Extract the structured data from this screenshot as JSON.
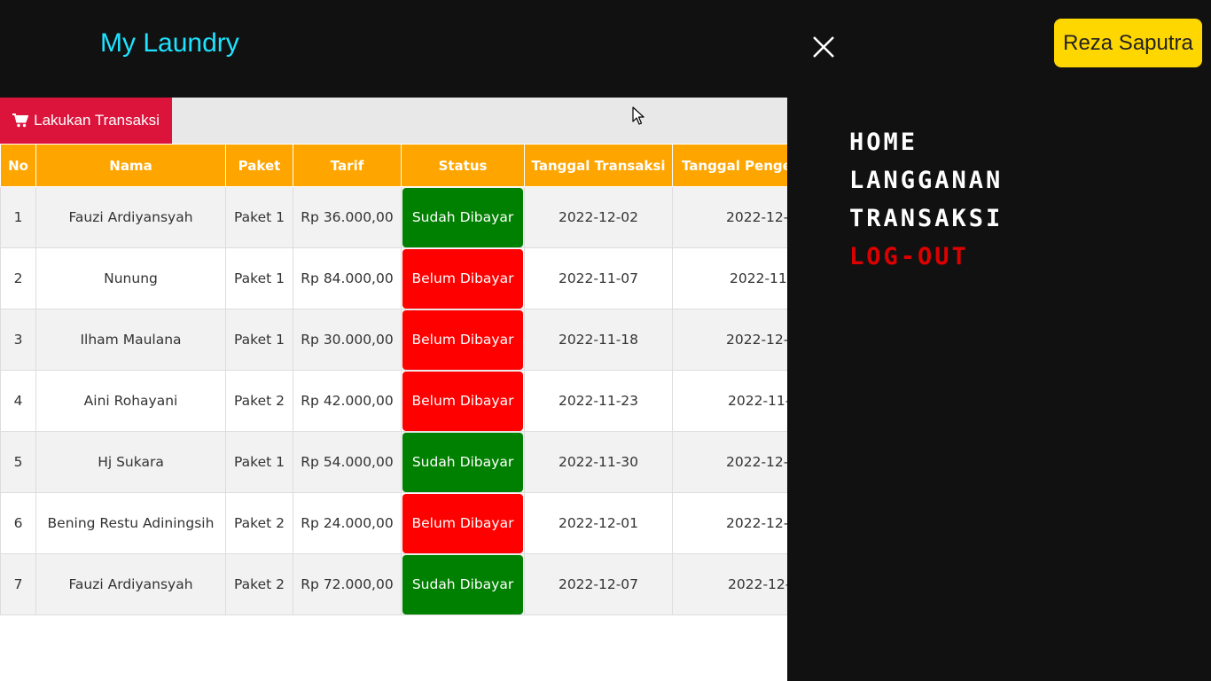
{
  "app": {
    "brand": "My Laundry"
  },
  "header": {
    "user_button": "Reza Saputra",
    "close_icon": "close-icon"
  },
  "toolbar": {
    "action_label": "Lakukan Transaksi",
    "action_icon": "cart-icon"
  },
  "nav": {
    "items": [
      {
        "label": "HOME"
      },
      {
        "label": "LANGGANAN"
      },
      {
        "label": "TRANSAKSI"
      },
      {
        "label": "LOG-OUT"
      }
    ]
  },
  "table": {
    "headers": [
      "No",
      "Nama",
      "Paket",
      "Tarif",
      "Status",
      "Tanggal Transaksi",
      "Tanggal Penge"
    ],
    "rows": [
      {
        "no": "1",
        "nama": "Fauzi Ardiyansyah",
        "paket": "Paket 1",
        "tarif": "Rp 36.000,00",
        "status": "Sudah Dibayar",
        "tgl_transaksi": "2022-12-02",
        "tgl_pengembalian": "2022-12-"
      },
      {
        "no": "2",
        "nama": "Nunung",
        "paket": "Paket 1",
        "tarif": "Rp 84.000,00",
        "status": "Belum Dibayar",
        "tgl_transaksi": "2022-11-07",
        "tgl_pengembalian": "2022-11-"
      },
      {
        "no": "3",
        "nama": "Ilham Maulana",
        "paket": "Paket 1",
        "tarif": "Rp 30.000,00",
        "status": "Belum Dibayar",
        "tgl_transaksi": "2022-11-18",
        "tgl_pengembalian": "2022-12-"
      },
      {
        "no": "4",
        "nama": "Aini Rohayani",
        "paket": "Paket 2",
        "tarif": "Rp 42.000,00",
        "status": "Belum Dibayar",
        "tgl_transaksi": "2022-11-23",
        "tgl_pengembalian": "2022-11-2"
      },
      {
        "no": "5",
        "nama": "Hj Sukara",
        "paket": "Paket 1",
        "tarif": "Rp 54.000,00",
        "status": "Sudah Dibayar",
        "tgl_transaksi": "2022-11-30",
        "tgl_pengembalian": "2022-12-"
      },
      {
        "no": "6",
        "nama": "Bening Restu Adiningsih",
        "paket": "Paket 2",
        "tarif": "Rp 24.000,00",
        "status": "Belum Dibayar",
        "tgl_transaksi": "2022-12-01",
        "tgl_pengembalian": "2022-12-"
      },
      {
        "no": "7",
        "nama": "Fauzi Ardiyansyah",
        "paket": "Paket 2",
        "tarif": "Rp 72.000,00",
        "status": "Sudah Dibayar",
        "tgl_transaksi": "2022-12-07",
        "tgl_pengembalian": "2022-12-"
      }
    ]
  },
  "colors": {
    "topbar": "#111111",
    "brand": "#1ee3ff",
    "action_button": "#dc143c",
    "table_header": "#ffa500",
    "status_paid": "#008000",
    "status_unpaid": "#ff0000",
    "user_button": "#ffd700",
    "logout": "#dd0000"
  },
  "status_colors": {
    "Sudah Dibayar": "#008000",
    "Belum Dibayar": "#ff0000"
  }
}
